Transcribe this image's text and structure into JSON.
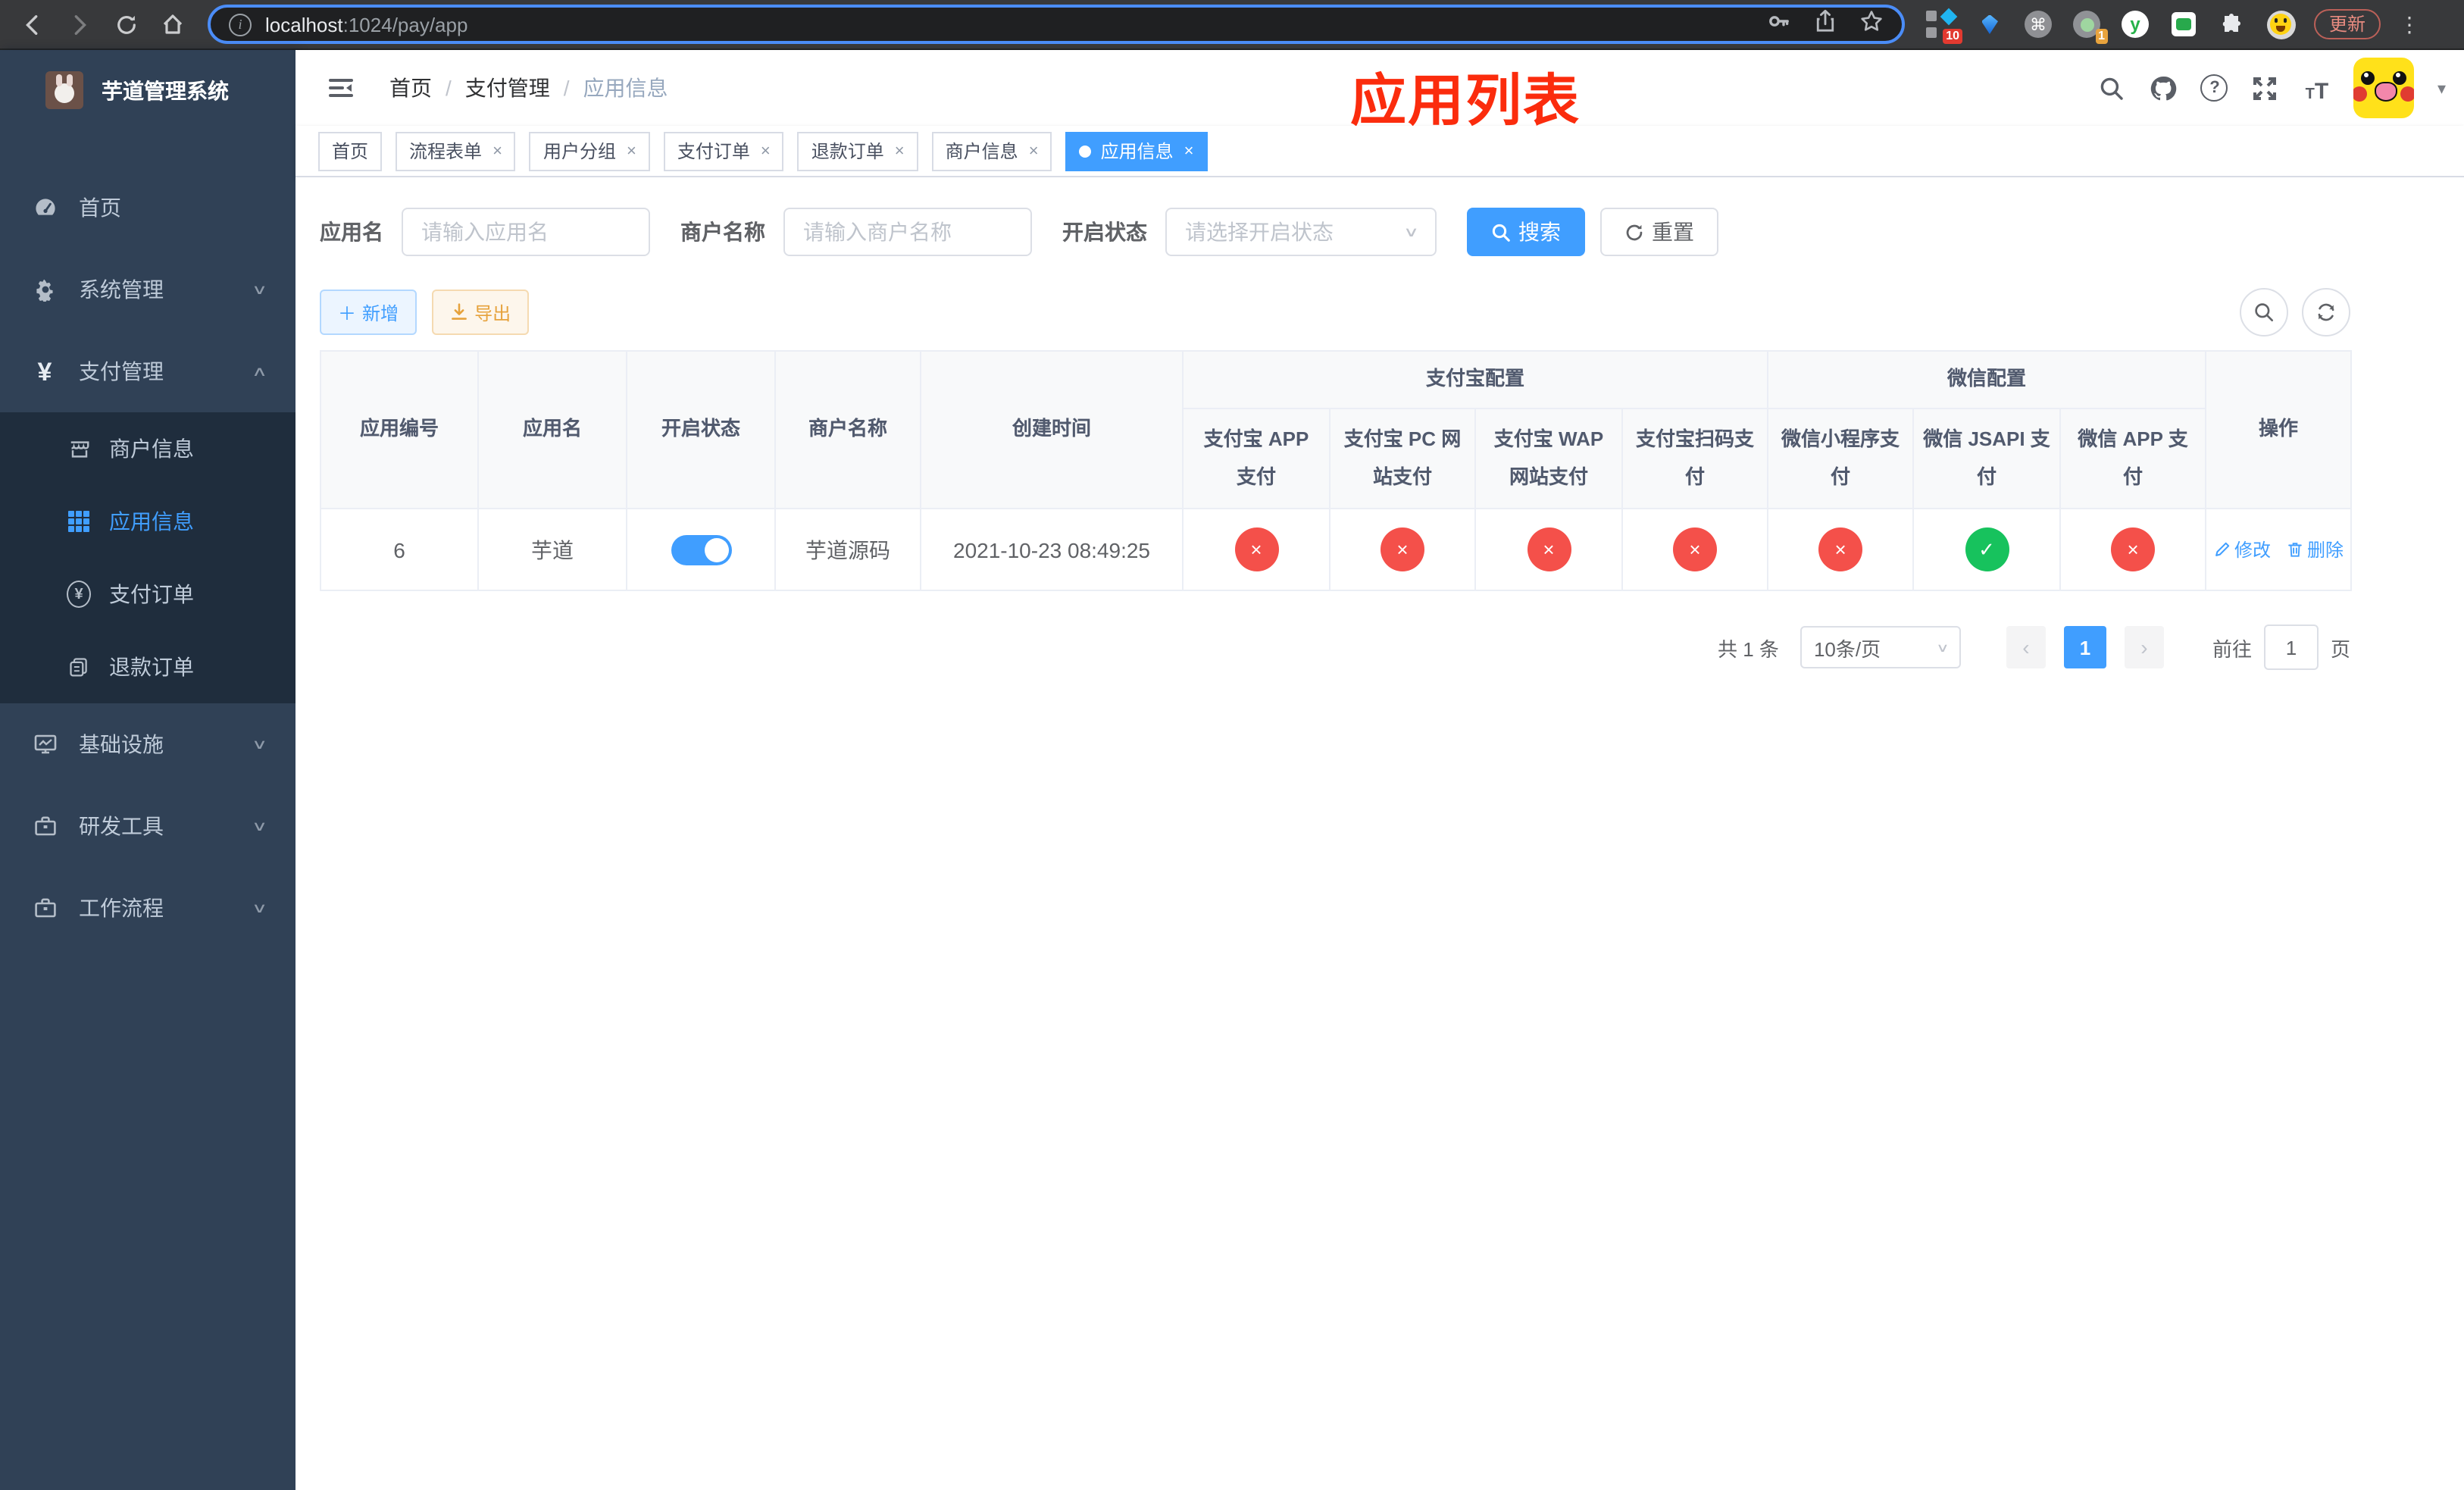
{
  "browser": {
    "url_host": "localhost",
    "url_rest": ":1024/pay/app",
    "update_label": "更新",
    "ext_badge_a": "10",
    "ext_badge_b": "1",
    "ext_letter": "y"
  },
  "sidebar": {
    "title": "芋道管理系统",
    "items": [
      {
        "label": "首页"
      },
      {
        "label": "系统管理"
      },
      {
        "label": "支付管理"
      },
      {
        "label": "商户信息"
      },
      {
        "label": "应用信息"
      },
      {
        "label": "支付订单"
      },
      {
        "label": "退款订单"
      },
      {
        "label": "基础设施"
      },
      {
        "label": "研发工具"
      },
      {
        "label": "工作流程"
      }
    ]
  },
  "header": {
    "crumbs": [
      "首页",
      "支付管理",
      "应用信息"
    ],
    "annotation": "应用列表"
  },
  "tabs": [
    {
      "label": "首页"
    },
    {
      "label": "流程表单"
    },
    {
      "label": "用户分组"
    },
    {
      "label": "支付订单"
    },
    {
      "label": "退款订单"
    },
    {
      "label": "商户信息"
    },
    {
      "label": "应用信息"
    }
  ],
  "filters": {
    "app_name_label": "应用名",
    "app_name_placeholder": "请输入应用名",
    "merchant_label": "商户名称",
    "merchant_placeholder": "请输入商户名称",
    "status_label": "开启状态",
    "status_placeholder": "请选择开启状态",
    "search_label": "搜索",
    "reset_label": "重置"
  },
  "toolbar": {
    "add_label": "新增",
    "export_label": "导出"
  },
  "table": {
    "group_alipay": "支付宝配置",
    "group_wechat": "微信配置",
    "columns": [
      "应用编号",
      "应用名",
      "开启状态",
      "商户名称",
      "创建时间",
      "支付宝 APP 支付",
      "支付宝 PC 网站支付",
      "支付宝 WAP 网站支付",
      "支付宝扫码支付",
      "微信小程序支付",
      "微信 JSAPI 支付",
      "微信 APP 支付",
      "操作"
    ],
    "row": {
      "id": "6",
      "name": "芋道",
      "enabled": true,
      "merchant": "芋道源码",
      "created": "2021-10-23 08:49:25",
      "configs": [
        "no",
        "no",
        "no",
        "no",
        "no",
        "yes",
        "no"
      ],
      "edit_label": "修改",
      "delete_label": "删除"
    }
  },
  "pagination": {
    "total": "共 1 条",
    "page_size": "10条/页",
    "page": "1",
    "goto_label": "前往",
    "goto_value": "1",
    "unit_label": "页"
  },
  "glyphs": {
    "close": "×",
    "check": "✓",
    "cross": "×",
    "chevron_down": "∨",
    "chevron_up": "∧",
    "slash": "/",
    "caret": "▾",
    "dots": "⋮",
    "cmd": "⌘",
    "plus": "＋",
    "prev": "‹",
    "next": "›",
    "question": "?",
    "info": "i",
    "yen": "¥",
    "t_small": "T",
    "t_big": "T"
  },
  "colors": {
    "accent": "#409EFF",
    "danger": "#f4504a",
    "success": "#17c25d",
    "warning": "#e6a23c",
    "sidebar_bg": "#304156",
    "submenu_bg": "#1f2d3d",
    "annotation_red": "#fb2c0d"
  }
}
